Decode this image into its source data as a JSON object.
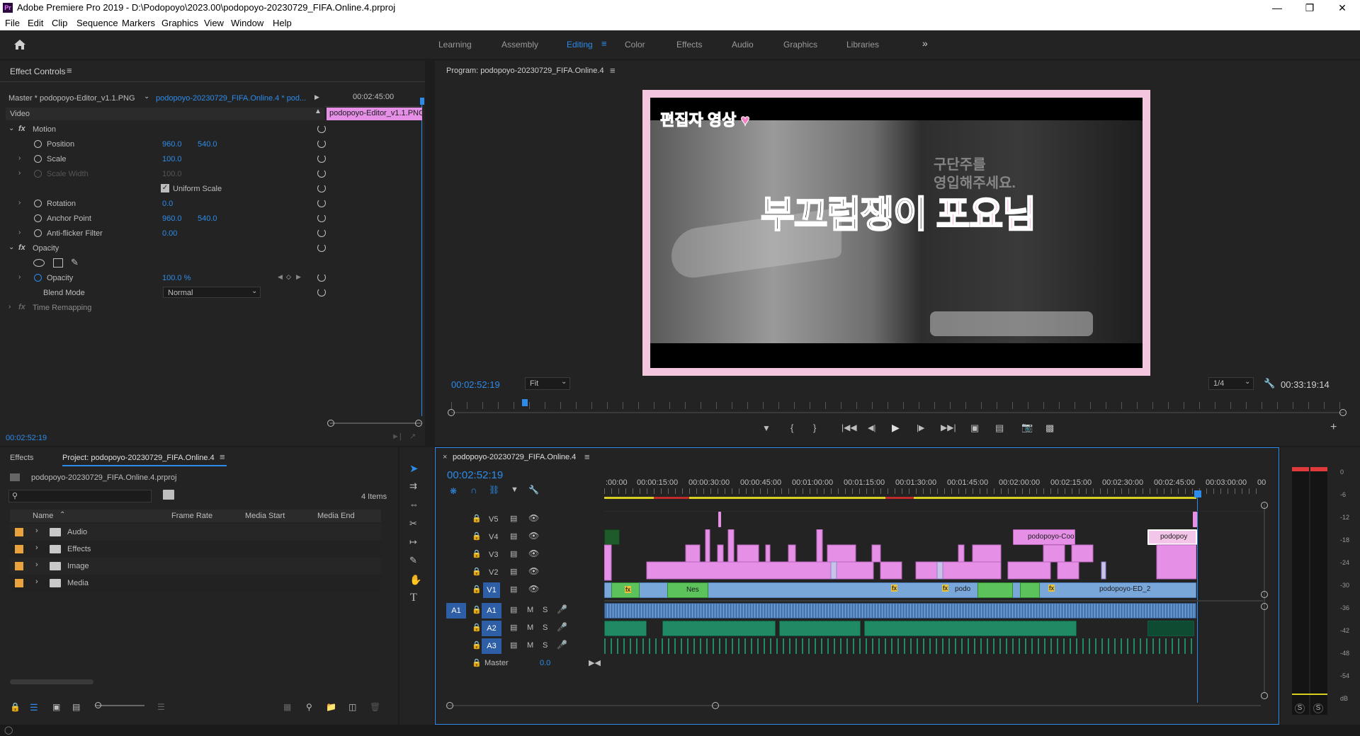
{
  "window": {
    "title": "Adobe Premiere Pro 2019 - D:\\Podopoyo\\2023.00\\podopoyo-20230729_FIFA.Online.4.prproj",
    "logo": "Pr"
  },
  "menu": [
    "File",
    "Edit",
    "Clip",
    "Sequence",
    "Markers",
    "Graphics",
    "View",
    "Window",
    "Help"
  ],
  "workspaces": [
    "Learning",
    "Assembly",
    "Editing",
    "Color",
    "Effects",
    "Audio",
    "Graphics",
    "Libraries"
  ],
  "workspace_active": "Editing",
  "effect_controls": {
    "title": "Effect Controls",
    "master_clip": "Master * podopoyo-Editor_v1.1.PNG",
    "sequence_clip": "podopoyo-20230729_FIFA.Online.4 * pod...",
    "mini_timecode": "00:02:45:00",
    "mini_clip": "podopoyo-Editor_v1.1.PNG",
    "section_video": "Video",
    "motion": "Motion",
    "position_label": "Position",
    "position_x": "960.0",
    "position_y": "540.0",
    "scale_label": "Scale",
    "scale": "100.0",
    "scale_width_label": "Scale Width",
    "scale_width": "100.0",
    "uniform_scale": "Uniform Scale",
    "rotation_label": "Rotation",
    "rotation": "0.0",
    "anchor_label": "Anchor Point",
    "anchor_x": "960.0",
    "anchor_y": "540.0",
    "antiflicker_label": "Anti-flicker Filter",
    "antiflicker": "0.00",
    "opacity_section": "Opacity",
    "opacity_label": "Opacity",
    "opacity": "100.0 %",
    "blend_label": "Blend Mode",
    "blend": "Normal",
    "time_remap": "Time Remapping",
    "timecode": "00:02:52:19"
  },
  "program": {
    "title": "Program: podopoyo-20230729_FIFA.Online.4",
    "timecode": "00:02:52:19",
    "fit": "Fit",
    "resolution": "1/4",
    "duration": "00:33:19:14",
    "overlay_tag": "편집자 영상",
    "overlay_main": "부끄럼쟁이 ",
    "overlay_name": "포요님",
    "side_text1": "구단주를",
    "side_text2": "영입해주세요."
  },
  "project": {
    "tab_effects": "Effects",
    "tab_project": "Project: podopoyo-20230729_FIFA.Online.4",
    "file": "podopoyo-20230729_FIFA.Online.4.prproj",
    "search_placeholder": "",
    "items_count": "4 Items",
    "columns": [
      "Name",
      "Frame Rate",
      "Media Start",
      "Media End"
    ],
    "rows": [
      "Audio",
      "Effects",
      "Image",
      "Media"
    ]
  },
  "timeline": {
    "title": "podopoyo-20230729_FIFA.Online.4",
    "timecode": "00:02:52:19",
    "ruler": [
      ":00:00",
      "00:00:15:00",
      "00:00:30:00",
      "00:00:45:00",
      "00:01:00:00",
      "00:01:15:00",
      "00:01:30:00",
      "00:01:45:00",
      "00:02:00:00",
      "00:02:15:00",
      "00:02:30:00",
      "00:02:45:00",
      "00:03:00:00",
      "00"
    ],
    "video_tracks": [
      "V5",
      "V4",
      "V3",
      "V2",
      "V1"
    ],
    "audio_tracks": [
      "A1",
      "A2",
      "A3"
    ],
    "master_label": "Master",
    "master_value": "0.0",
    "source_patch": "A1",
    "clip_labels": [
      "podopoyo-Coo",
      "podopoy",
      "Nes",
      "podo",
      "podopoyo-ED_2"
    ],
    "m": "M",
    "s": "S"
  },
  "meter": {
    "labels": [
      "0",
      "-6",
      "-12",
      "-18",
      "-24",
      "-30",
      "-36",
      "-42",
      "-48",
      "-54",
      "dB"
    ],
    "solo": [
      "S",
      "S"
    ]
  },
  "colors": {
    "accent": "#2d8ceb",
    "pink_clip": "#e590e6",
    "video_clip": "#7aa7da",
    "green_clip": "#5cc25c",
    "audio_clip": "#4a78b3",
    "label_orange": "#e8a33d"
  }
}
